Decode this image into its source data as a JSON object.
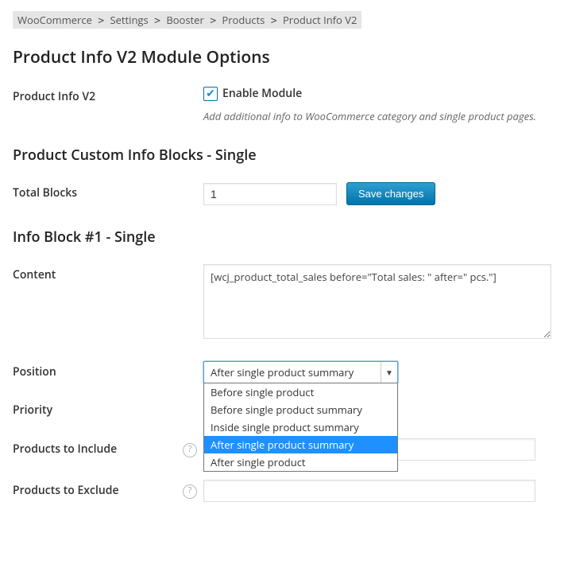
{
  "breadcrumb": [
    "WooCommerce",
    "Settings",
    "Booster",
    "Products",
    "Product Info V2"
  ],
  "section_module": {
    "title": "Product Info V2 Module Options",
    "row_label": "Product Info V2",
    "checkbox_label": "Enable Module",
    "checkbox_checked": true,
    "description": "Add additional info to WooCommerce category and single product pages."
  },
  "section_blocks": {
    "title": "Product Custom Info Blocks - Single",
    "total_blocks_label": "Total Blocks",
    "total_blocks_value": "1",
    "save_button": "Save changes"
  },
  "section_block1": {
    "title": "Info Block #1 - Single",
    "content_label": "Content",
    "content_value": "[wcj_product_total_sales before=\"Total sales: \" after=\" pcs.\"]",
    "position_label": "Position",
    "position_selected": "After single product summary",
    "position_options": [
      "Before single product",
      "Before single product summary",
      "Inside single product summary",
      "After single product summary",
      "After single product"
    ],
    "priority_label": "Priority",
    "include_label": "Products to Include",
    "exclude_label": "Products to Exclude"
  }
}
